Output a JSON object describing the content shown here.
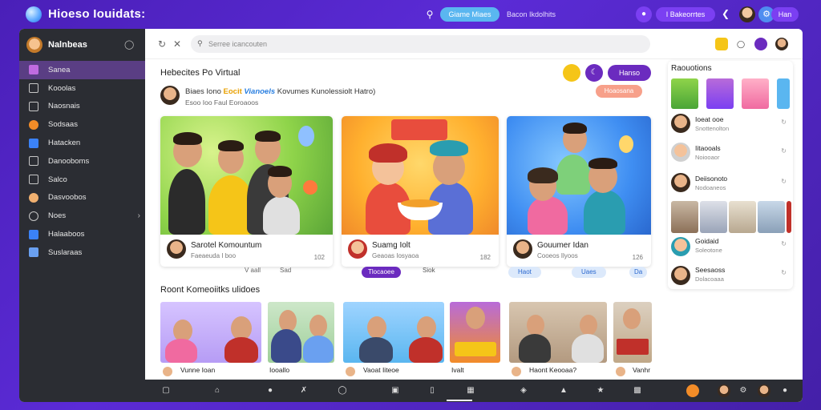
{
  "brand": {
    "name": "Hioeso Iouidats:"
  },
  "topbar": {
    "pill_label": "Giame Miaes",
    "link_text": "Bacon Ikdolhits",
    "pill2_label": "I Bakeorrtes",
    "pill3_label": "Han"
  },
  "sidebar": {
    "title": "Nalnbeas",
    "items": [
      {
        "label": "Sanea",
        "icon": "home-icon",
        "color": "#c06be0"
      },
      {
        "label": "Kooolas",
        "icon": "folder-icon",
        "color": "#c7c7c7"
      },
      {
        "label": "Naosnais",
        "icon": "bag-icon",
        "color": "#c7c7c7"
      },
      {
        "label": "Sodsaas",
        "icon": "orange-circle-icon",
        "color": "#f28c28"
      },
      {
        "label": "Hatacken",
        "icon": "image-icon",
        "color": "#3b82f6"
      },
      {
        "label": "Danooboms",
        "icon": "box-icon",
        "color": "#c7c7c7"
      },
      {
        "label": "Salco",
        "icon": "document-icon",
        "color": "#c7c7c7"
      },
      {
        "label": "Dasvoobos",
        "icon": "user-icon",
        "color": "#f0b070"
      },
      {
        "label": "Noes",
        "icon": "clock-icon",
        "color": "#c7c7c7"
      },
      {
        "label": "Halaaboos",
        "icon": "chart-icon",
        "color": "#3b82f6"
      },
      {
        "label": "Suslaraas",
        "icon": "folder-blue-icon",
        "color": "#6aa0f0"
      }
    ]
  },
  "addrbar": {
    "search_placeholder": "Serree icancouten"
  },
  "feature": {
    "title": "Hebecites Po Virtual",
    "pill_label": "Hanso",
    "follow_label": "Hoaosana",
    "poster_prefix": "Biaes Iono ",
    "poster_hl1": "Eocit ",
    "poster_hl2": "Vianoels ",
    "poster_suffix": "Kovumes Kunolessiolt Hatro)",
    "poster_sub": "Esoo Ioo Faul Eoroaoos"
  },
  "cards": [
    {
      "title": "Sarotel Komountum",
      "sub": "Faeaeuda I boo",
      "count": "102",
      "act1": "V aall",
      "act2": "Sad"
    },
    {
      "title": "Suamg Iolt",
      "sub": "Geaoas Iosyaoa",
      "count": "182",
      "act1": "Tlocaoee",
      "act2": "Siok"
    },
    {
      "title": "Gouumer Idan",
      "sub": "Cooeos Ilyoos",
      "count": "126",
      "act1": "Haot",
      "act2": "Uaes",
      "act3": "Da"
    }
  ],
  "recent": {
    "title": "Roont Komeoiitks ulidoes",
    "items": [
      {
        "label": "Vunne Ioan"
      },
      {
        "label": "Iooallo"
      },
      {
        "label": "Vaoat Iiteoe"
      },
      {
        "label": "Ivalt"
      },
      {
        "label": "Haont Keooaa?"
      },
      {
        "label": "Vanhr"
      }
    ]
  },
  "rpanel": {
    "title": "Raouotions",
    "users": [
      {
        "name": "Ioeat ooe",
        "sub": "Snottenolton"
      },
      {
        "name": "Iitaooals",
        "sub": "Noiooaor"
      },
      {
        "name": "Deiisonoto",
        "sub": "Nodoaneos"
      },
      {
        "name": "Goidaid",
        "sub": "Soleotone"
      },
      {
        "name": "Seesaoss",
        "sub": "Dolacoaaa"
      }
    ]
  },
  "colors": {
    "background": "#5b2bd6",
    "sidebar": "#2b2d33",
    "sidebar_active": "#5a3e84",
    "accent_purple": "#6b2bbf",
    "accent_blue": "#5ab6f0"
  }
}
